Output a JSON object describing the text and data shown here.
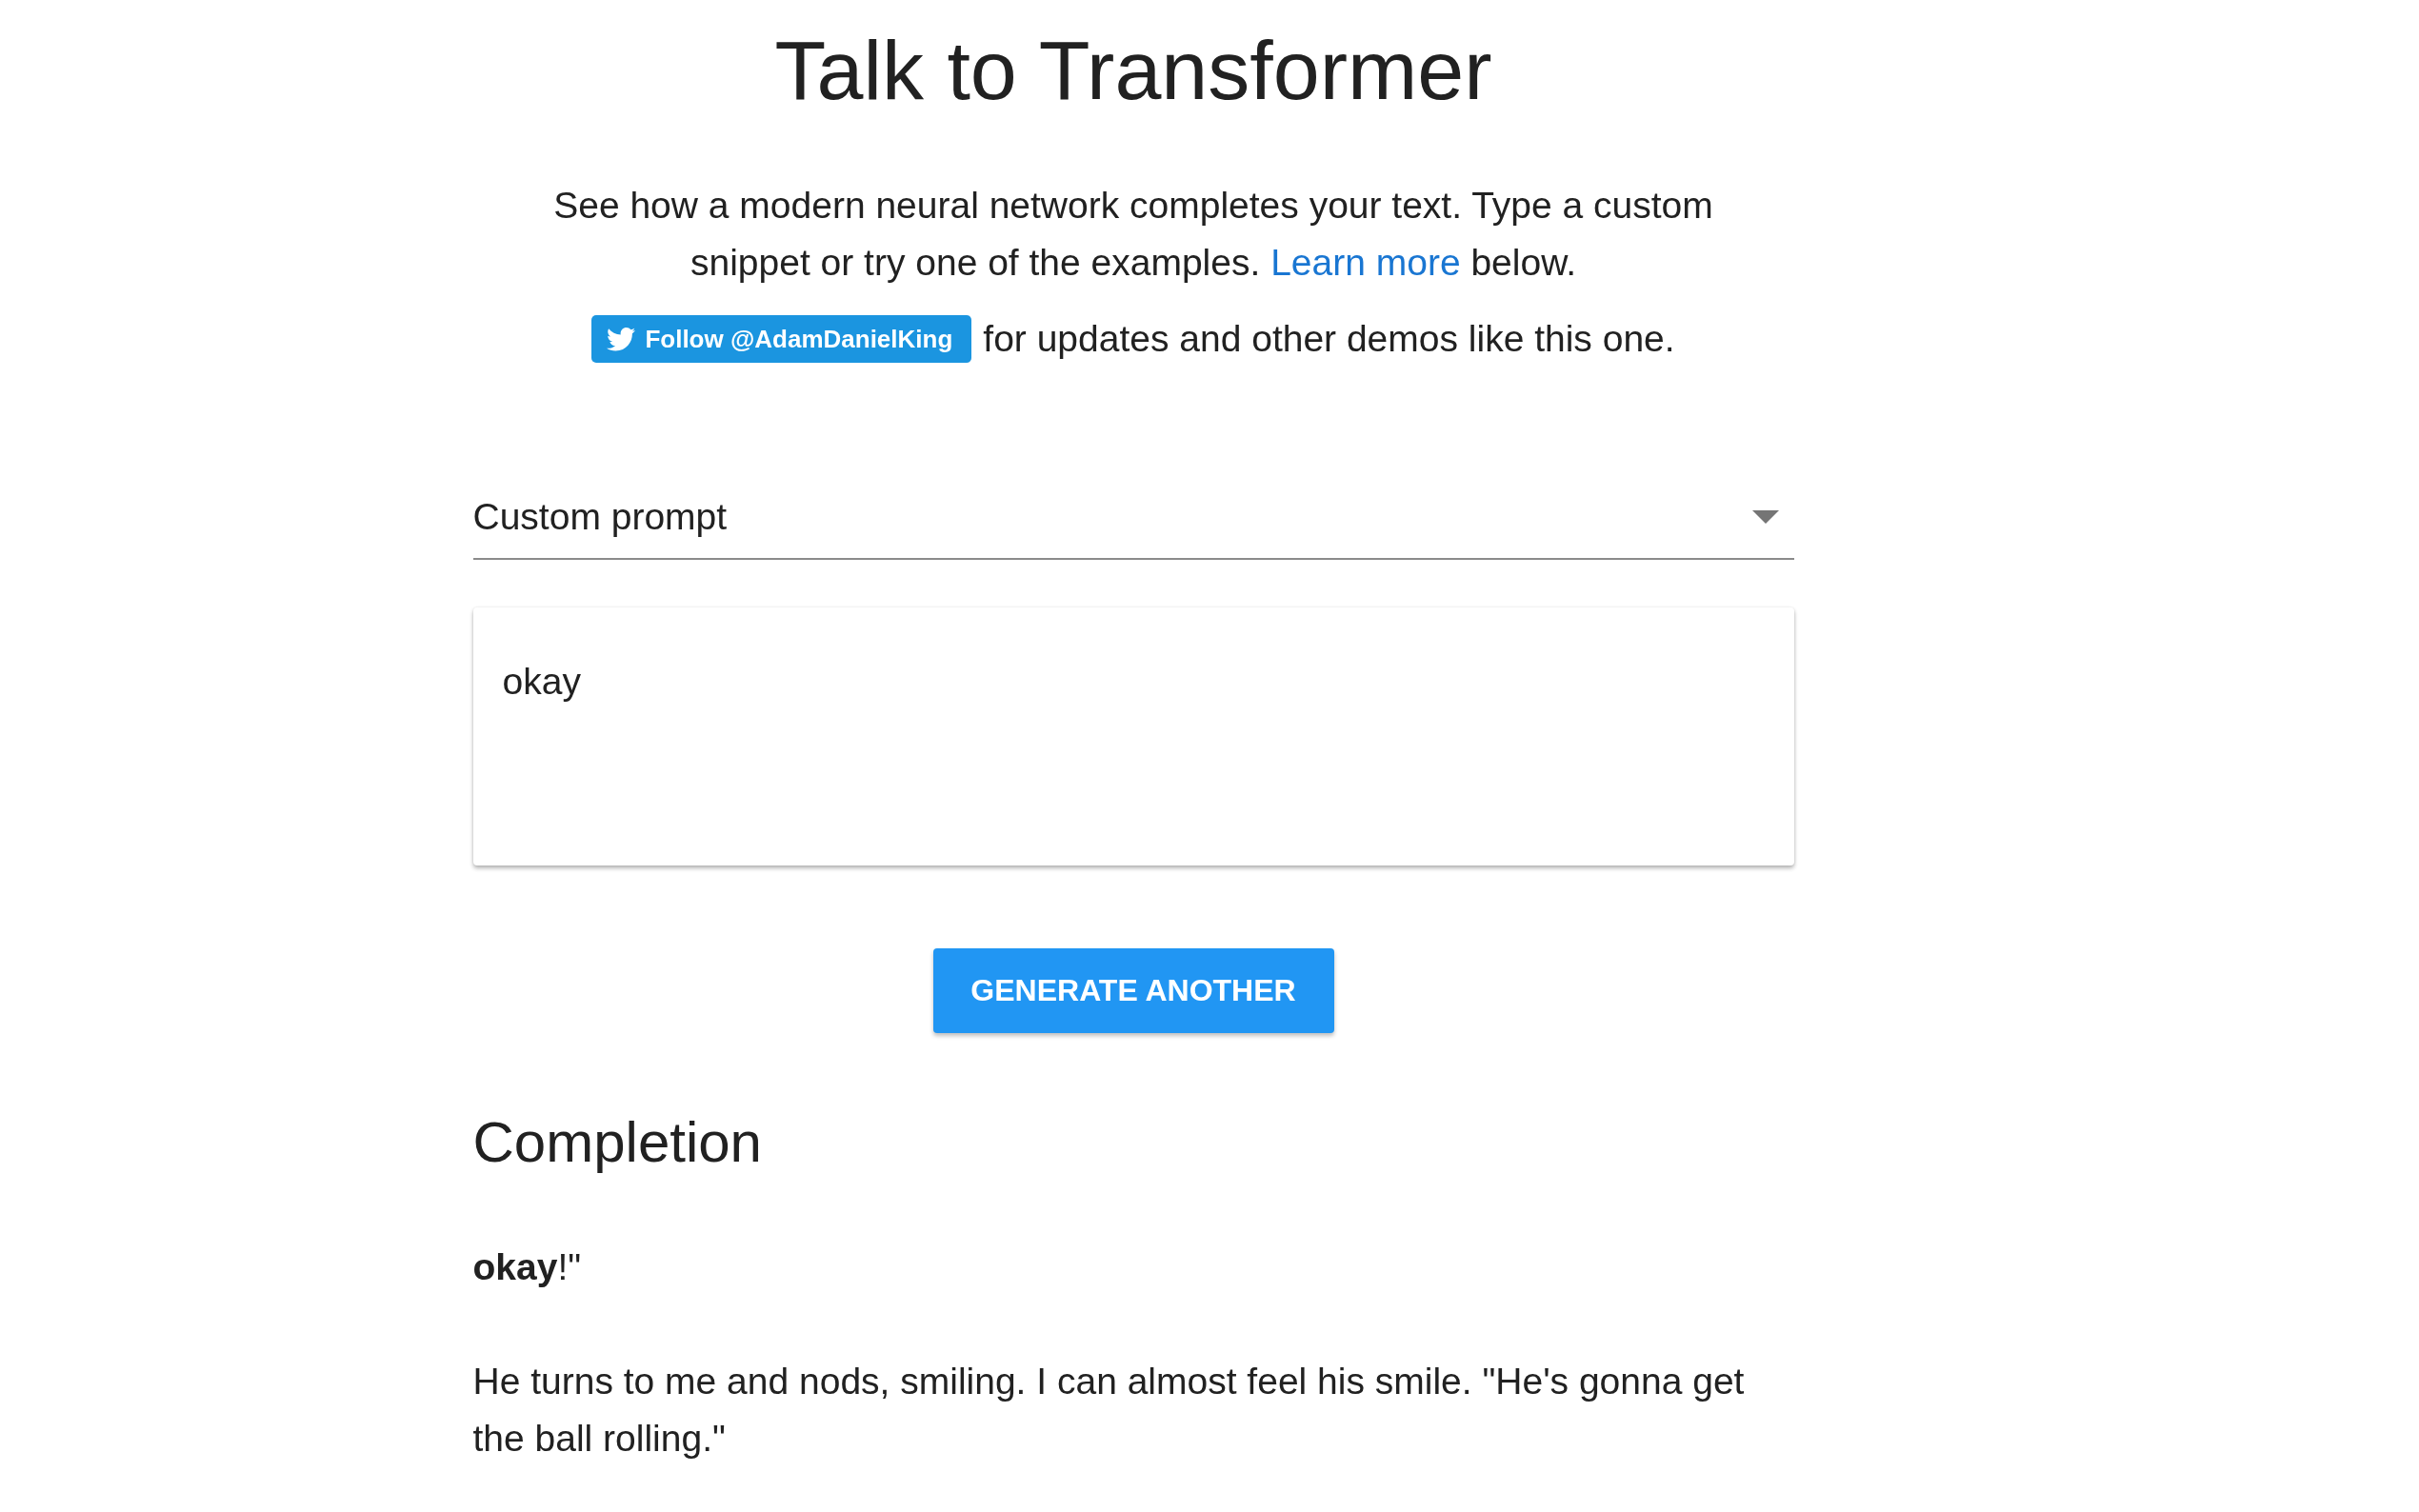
{
  "header": {
    "title": "Talk to Transformer",
    "intro": {
      "text_before": "See how a modern neural network completes your text. Type a custom snippet or try one of the examples.",
      "link": "Learn more",
      "text_after": "below."
    },
    "follow": {
      "button": "Follow @AdamDanielKing",
      "note": "for updates and other demos like this one."
    }
  },
  "prompt_select": {
    "value": "Custom prompt"
  },
  "prompt_input": {
    "value": "okay"
  },
  "generate_button": "GENERATE ANOTHER",
  "completion": {
    "heading": "Completion",
    "paragraphs": [
      "**okay**!\"",
      "He turns to me and nods, smiling. I can almost feel his smile. \"He's gonna get the ball rolling.\""
    ]
  }
}
